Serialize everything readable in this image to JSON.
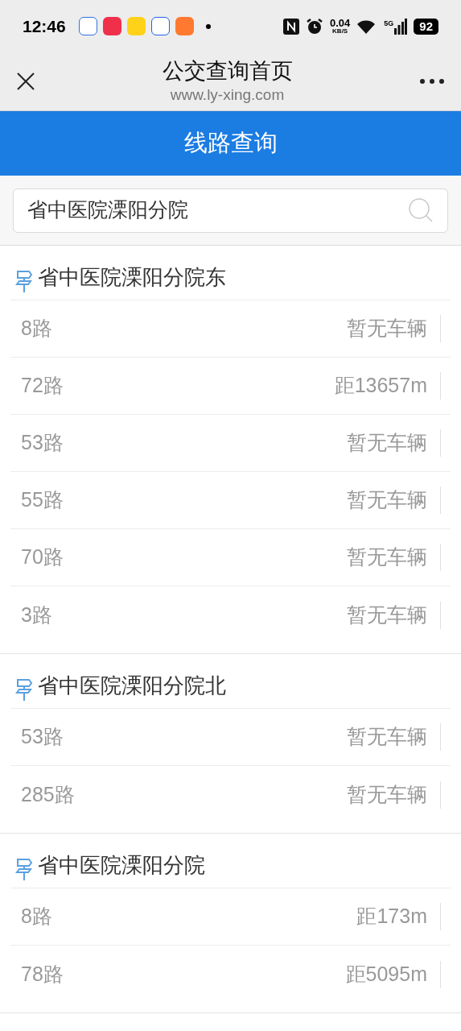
{
  "status_bar": {
    "time": "12:46",
    "speed": "0.04",
    "speed_unit": "KB/S",
    "network": "5G",
    "battery": "92"
  },
  "header": {
    "title": "公交查询首页",
    "url": "www.ly-xing.com"
  },
  "banner": {
    "title": "线路查询"
  },
  "search": {
    "value": "省中医院溧阳分院"
  },
  "stops": [
    {
      "name": "省中医院溧阳分院东",
      "routes": [
        {
          "route": "8路",
          "status": "暂无车辆"
        },
        {
          "route": "72路",
          "status": "距13657m"
        },
        {
          "route": "53路",
          "status": "暂无车辆"
        },
        {
          "route": "55路",
          "status": "暂无车辆"
        },
        {
          "route": "70路",
          "status": "暂无车辆"
        },
        {
          "route": "3路",
          "status": "暂无车辆"
        }
      ]
    },
    {
      "name": "省中医院溧阳分院北",
      "routes": [
        {
          "route": "53路",
          "status": "暂无车辆"
        },
        {
          "route": "285路",
          "status": "暂无车辆"
        }
      ]
    },
    {
      "name": "省中医院溧阳分院",
      "routes": [
        {
          "route": "8路",
          "status": "距173m"
        },
        {
          "route": "78路",
          "status": "距5095m"
        }
      ]
    }
  ]
}
